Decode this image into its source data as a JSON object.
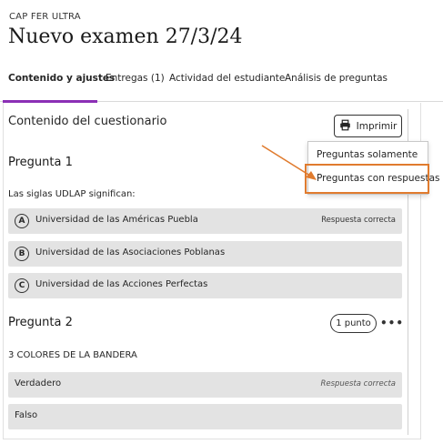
{
  "header": {
    "course": "CAP FER ULTRA",
    "title": "Nuevo examen 27/3/24"
  },
  "tabs": [
    {
      "label": "Contenido y ajustes",
      "active": true
    },
    {
      "label": "Entregas (1)",
      "active": false
    },
    {
      "label": "Actividad del estudiante",
      "active": false
    },
    {
      "label": "Análisis de preguntas",
      "active": false
    }
  ],
  "content": {
    "section_title": "Contenido del cuestionario",
    "print_label": "Imprimir",
    "print_icon": "printer-icon"
  },
  "dropdown": {
    "items": [
      {
        "label": "Preguntas solamente"
      },
      {
        "label": "Preguntas con respuestas",
        "highlighted": true
      }
    ],
    "highlight_color": "#e07b2e"
  },
  "questions": [
    {
      "heading": "Pregunta 1",
      "text": "Las siglas UDLAP significan:",
      "answers": [
        {
          "letter": "A",
          "text": "Universidad de las Américas Puebla",
          "correct_label": "Respuesta correcta"
        },
        {
          "letter": "B",
          "text": "Universidad de las Asociaciones Poblanas"
        },
        {
          "letter": "C",
          "text": "Universidad de las Acciones Perfectas"
        }
      ]
    },
    {
      "heading": "Pregunta 2",
      "points": "1 punto",
      "more": "•••",
      "text": "3 COLORES DE LA BANDERA",
      "answers": [
        {
          "text": "Verdadero",
          "correct_label": "Respuesta correcta"
        },
        {
          "text": "Falso"
        }
      ]
    }
  ],
  "colors": {
    "accent": "#8b2fb5",
    "annotation": "#e07b2e",
    "answer_bg": "#e3e3e3"
  }
}
